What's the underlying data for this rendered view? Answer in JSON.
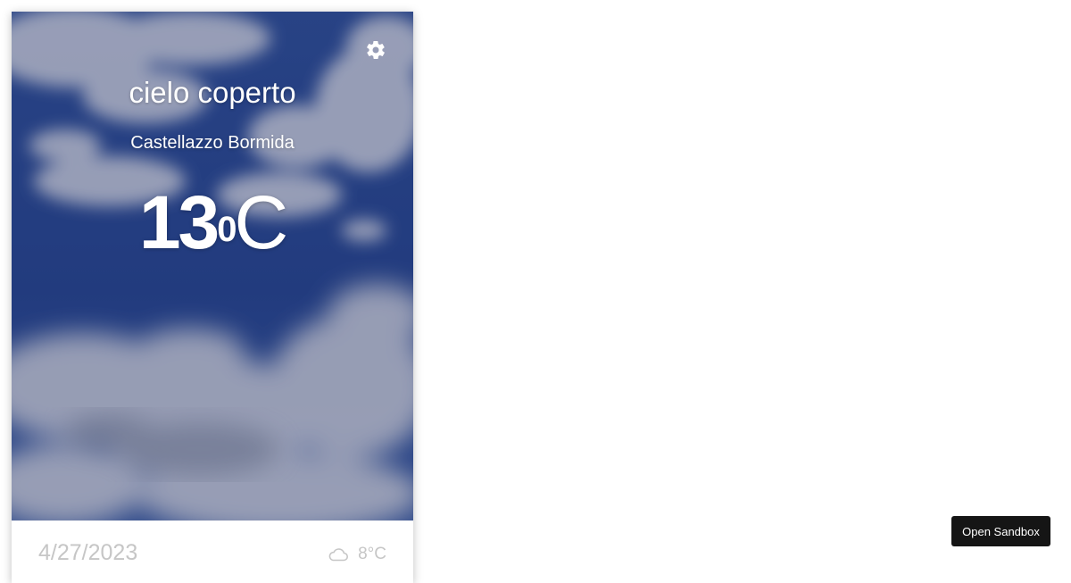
{
  "weather": {
    "description": "cielo coperto",
    "city": "Castellazzo Bormida",
    "temp_value": "13",
    "temp_degree": "0",
    "temp_unit": "C"
  },
  "forecast": [
    {
      "date": "4/27/2023",
      "temp": "8°C",
      "icon": "cloud-icon"
    }
  ],
  "sandbox": {
    "label": "Open Sandbox"
  },
  "colors": {
    "sky": "#2a4a8f",
    "forecast_text": "#c6c6c6",
    "sandbox_bg": "#151515"
  }
}
